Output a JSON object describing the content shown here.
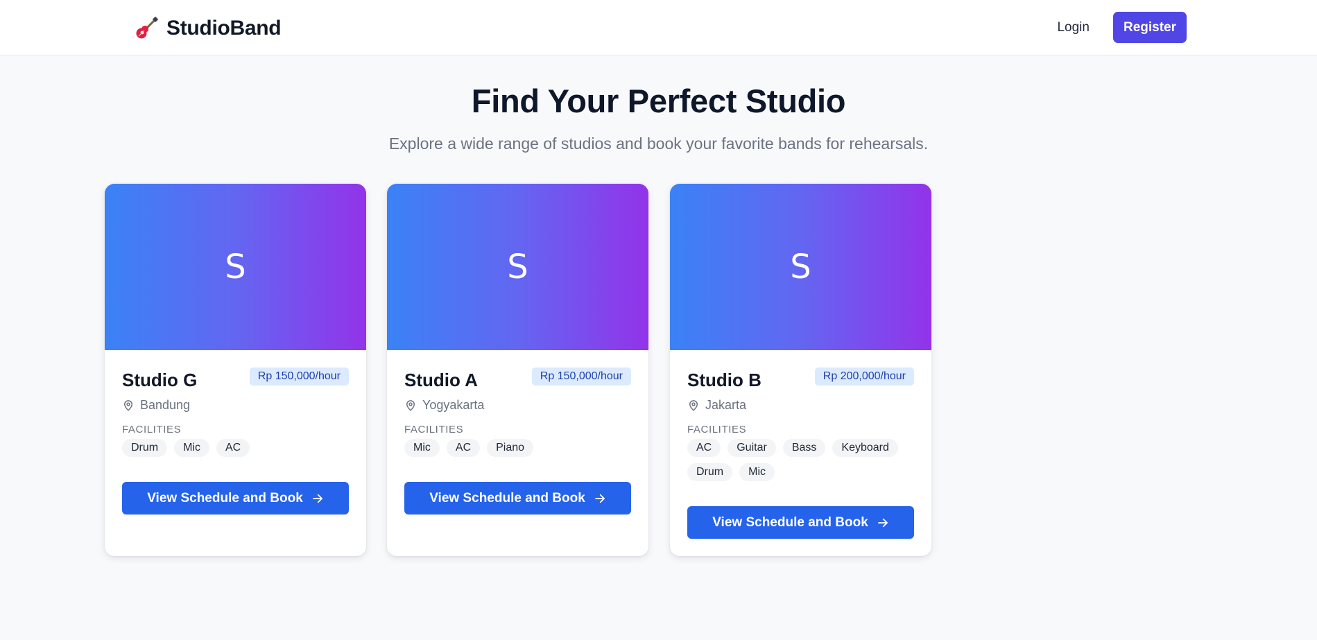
{
  "navbar": {
    "brand_name": "StudioBand",
    "brand_icon": "guitar-icon",
    "login_label": "Login",
    "register_label": "Register"
  },
  "hero": {
    "title": "Find Your Perfect Studio",
    "subtitle": "Explore a wide range of studios and book your favorite bands for rehearsals."
  },
  "facilities_label": "FACILITIES",
  "cards": [
    {
      "banner_letter": "S",
      "name": "Studio G",
      "price": "Rp 150,000/hour",
      "location": "Bandung",
      "facilities": [
        "Drum",
        "Mic",
        "AC"
      ],
      "button_label": "View Schedule and Book"
    },
    {
      "banner_letter": "S",
      "name": "Studio A",
      "price": "Rp 150,000/hour",
      "location": "Yogyakarta",
      "facilities": [
        "Mic",
        "AC",
        "Piano"
      ],
      "button_label": "View Schedule and Book"
    },
    {
      "banner_letter": "S",
      "name": "Studio B",
      "price": "Rp 200,000/hour",
      "location": "Jakarta",
      "facilities": [
        "AC",
        "Guitar",
        "Bass",
        "Keyboard",
        "Drum",
        "Mic"
      ],
      "button_label": "View Schedule and Book"
    }
  ],
  "colors": {
    "brand_accent": "#4f46e5",
    "button": "#2563eb",
    "gradient_start": "#3b82f6",
    "gradient_end": "#9333ea",
    "price_badge_bg": "#dbeafe",
    "price_badge_text": "#1e40af"
  }
}
